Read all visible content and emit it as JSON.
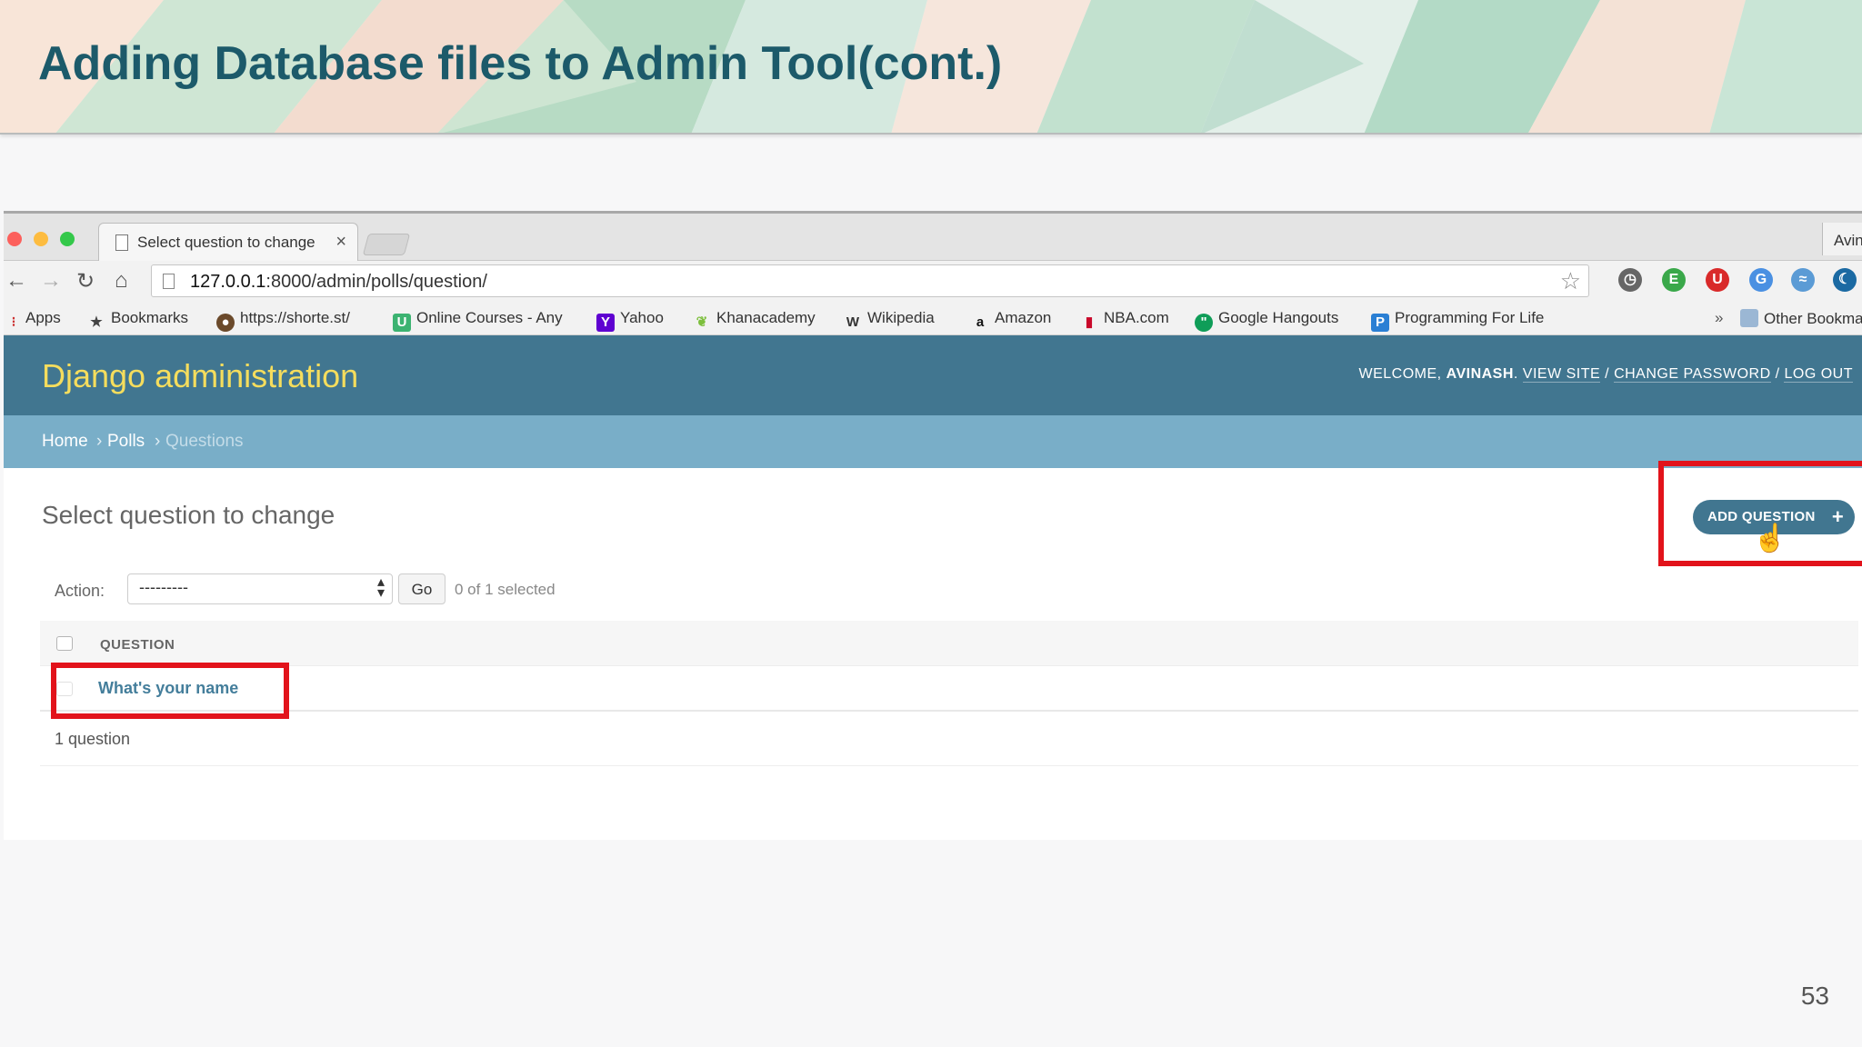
{
  "slide": {
    "title": "Adding Database files to Admin Tool(cont.)",
    "page_number": "53"
  },
  "browser": {
    "tab_title": "Select question to change",
    "tab_close": "×",
    "profile": "Avinash",
    "url_host": "127.0.0.1",
    "url_rest": ":8000/admin/polls/question/",
    "bookmarks": [
      {
        "label": "Apps",
        "icon": "apps-grid-icon"
      },
      {
        "label": "Bookmarks",
        "icon": "star-icon"
      },
      {
        "label": "https://shorte.st/",
        "icon": "shortest-icon"
      },
      {
        "label": "Online Courses - Any",
        "icon": "udemy-icon"
      },
      {
        "label": "Yahoo",
        "icon": "yahoo-icon"
      },
      {
        "label": "Khanacademy",
        "icon": "leaf-icon"
      },
      {
        "label": "Wikipedia",
        "icon": "wikipedia-icon"
      },
      {
        "label": "Amazon",
        "icon": "amazon-icon"
      },
      {
        "label": "NBA.com",
        "icon": "nba-icon"
      },
      {
        "label": "Google Hangouts",
        "icon": "hangouts-icon"
      },
      {
        "label": "Programming For Life",
        "icon": "p-icon"
      }
    ],
    "more_bookmarks": "»",
    "other_bookmarks": "Other Bookmarks"
  },
  "django": {
    "brand": "Django administration",
    "welcome": "WELCOME,",
    "username": "AVINASH",
    "view_site": "VIEW SITE",
    "change_password": "CHANGE PASSWORD",
    "log_out": "LOG OUT",
    "sep": "/",
    "breadcrumbs": [
      "Home",
      "Polls",
      "Questions"
    ],
    "crumb_sep": "›",
    "page_title": "Select question to change",
    "add_button": "ADD QUESTION",
    "add_plus": "+",
    "action_label": "Action:",
    "action_value": "---------",
    "go_label": "Go",
    "selected_count": "0 of 1 selected",
    "column_header": "QUESTION",
    "rows": [
      "What's your name"
    ],
    "result_count": "1 question"
  },
  "colors": {
    "django_header": "#417690",
    "django_brand": "#f5dd5d",
    "breadcrumbs": "#79aec8",
    "highlight": "#e2131b",
    "slide_title": "#1c5a6a"
  }
}
